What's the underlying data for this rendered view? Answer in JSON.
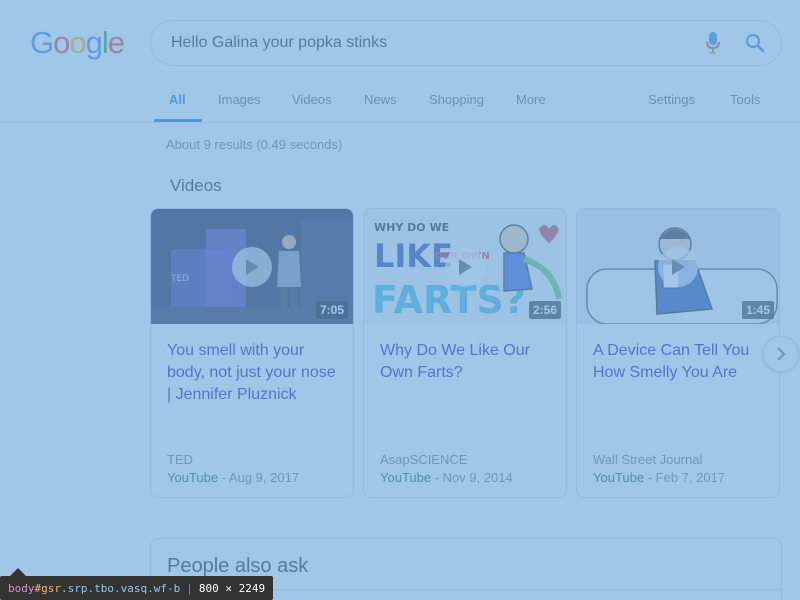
{
  "logo": {
    "letters": [
      "G",
      "o",
      "o",
      "g",
      "l",
      "e"
    ],
    "colors": [
      "#4285f4",
      "#ea4335",
      "#fbbc05",
      "#4285f4",
      "#34a853",
      "#ea4335"
    ]
  },
  "search": {
    "query": "Hello Galina your popka stinks",
    "mic_icon": "microphone-icon",
    "search_icon": "search-icon"
  },
  "tabs": {
    "all": "All",
    "images": "Images",
    "videos": "Videos",
    "news": "News",
    "shopping": "Shopping",
    "more": "More",
    "settings": "Settings",
    "tools": "Tools"
  },
  "results": {
    "stats": "About 9 results (0.49 seconds)"
  },
  "videos_section": {
    "heading": "Videos",
    "cards": [
      {
        "title": "You smell with your body, not just your nose | Jennifer Pluznick",
        "duration": "7:05",
        "source": "TED",
        "platform": "YouTube",
        "date": " - Aug 9, 2017"
      },
      {
        "title": "Why Do We Like Our Own Farts?",
        "duration": "2:56",
        "source": "AsapSCIENCE",
        "platform": "YouTube",
        "date": " - Nov 9, 2014",
        "thumb_text_1": "WHY DO WE",
        "thumb_text_2": "LIKE",
        "thumb_text_3": "OUR OWN",
        "thumb_text_4": "FARTS?"
      },
      {
        "title": "A Device Can Tell You How Smelly You Are",
        "duration": "1:45",
        "source": "Wall Street Journal",
        "platform": "YouTube",
        "date": " - Feb 7, 2017"
      }
    ]
  },
  "people_also_ask": {
    "title": "People also ask"
  },
  "devtools": {
    "tag": "body",
    "id": "#gsr",
    "classes": ".srp.tbo.vasq.wf-b",
    "size": "800 × 2249"
  }
}
